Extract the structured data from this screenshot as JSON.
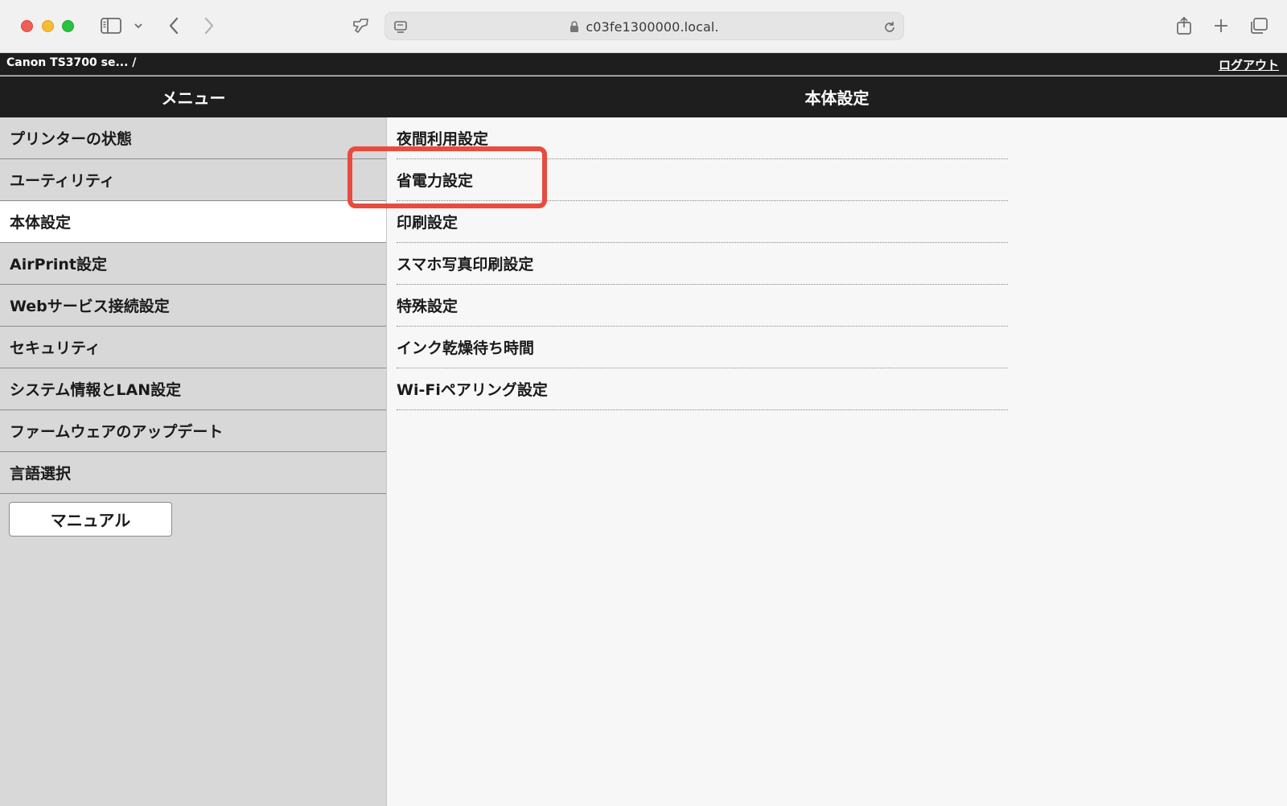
{
  "browser": {
    "url": "c03fe1300000.local."
  },
  "topbar": {
    "printer_name": "Canon TS3700 se... /",
    "logout_label": "ログアウト"
  },
  "header": {
    "menu_title": "メニュー",
    "section_title": "本体設定"
  },
  "sidebar": {
    "items": [
      {
        "label": "プリンターの状態"
      },
      {
        "label": "ユーティリティ"
      },
      {
        "label": "本体設定"
      },
      {
        "label": "AirPrint設定"
      },
      {
        "label": "Webサービス接続設定"
      },
      {
        "label": "セキュリティ"
      },
      {
        "label": "システム情報とLAN設定"
      },
      {
        "label": "ファームウェアのアップデート"
      },
      {
        "label": "言語選択"
      }
    ],
    "manual_label": "マニュアル"
  },
  "content": {
    "items": [
      {
        "label": "夜間利用設定"
      },
      {
        "label": "省電力設定"
      },
      {
        "label": "印刷設定"
      },
      {
        "label": "スマホ写真印刷設定"
      },
      {
        "label": "特殊設定"
      },
      {
        "label": "インク乾燥待ち時間"
      },
      {
        "label": "Wi-Fiペアリング設定"
      }
    ]
  },
  "colors": {
    "highlight": "#e84c3f",
    "header_bg": "#1e1e1e"
  }
}
